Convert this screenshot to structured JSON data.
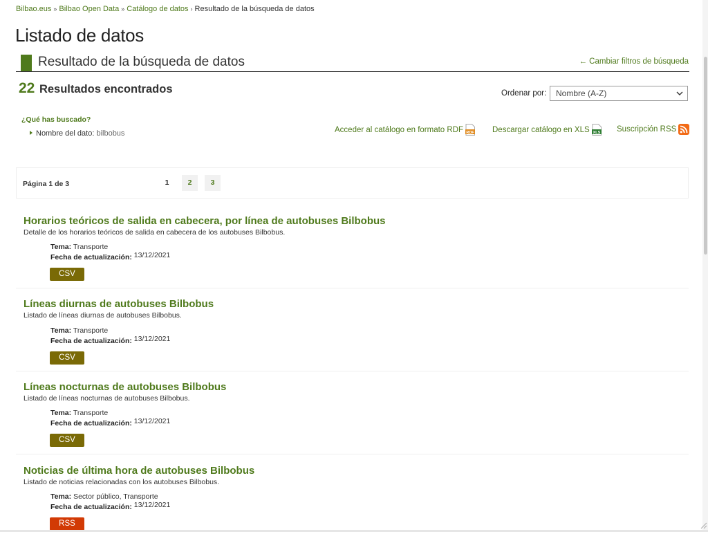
{
  "breadcrumb": [
    {
      "label": "Bilbao.eus",
      "link": true
    },
    {
      "label": "Bilbao Open Data",
      "link": true
    },
    {
      "label": "Catálogo de datos",
      "link": true
    },
    {
      "label": "Resultado de la búsqueda de datos",
      "link": false
    }
  ],
  "page_title": "Listado de datos",
  "section": {
    "title": "Resultado de la búsqueda de datos",
    "change_filters": "← Cambiar filtros de búsqueda"
  },
  "results": {
    "count": "22",
    "label": "Resultados encontrados"
  },
  "sort": {
    "label": "Ordenar por:",
    "value": "Nombre (A-Z)"
  },
  "search_summary": {
    "title": "¿Qué has buscado?",
    "criteria_label": "Nombre del dato:",
    "criteria_value": "bilbobus"
  },
  "downloads": {
    "rdf": "Acceder al catálogo en formato RDF",
    "xls": "Descargar catálogo en XLS",
    "rss": "Suscripción RSS"
  },
  "pagination": {
    "label": "Página 1 de 3",
    "pages": [
      "1",
      "2",
      "3"
    ],
    "current": "1"
  },
  "labels": {
    "tema": "Tema:",
    "fecha": "Fecha de actualización:"
  },
  "datasets": [
    {
      "title": "Horarios teóricos de salida en cabecera, por línea de autobuses Bilbobus",
      "description": "Detalle de los horarios teóricos de salida en cabecera de los autobuses Bilbobus.",
      "tema": "Transporte",
      "fecha": "13/12/2021",
      "format": "CSV"
    },
    {
      "title": "Líneas diurnas de autobuses Bilbobus",
      "description": "Listado de líneas diurnas de autobuses Bilbobus.",
      "tema": "Transporte",
      "fecha": "13/12/2021",
      "format": "CSV"
    },
    {
      "title": "Líneas nocturnas de autobuses Bilbobus",
      "description": "Listado de líneas nocturnas de autobuses Bilbobus.",
      "tema": "Transporte",
      "fecha": "13/12/2021",
      "format": "CSV"
    },
    {
      "title": "Noticias de última hora de autobuses Bilbobus",
      "description": "Listado de noticias relacionadas con los autobuses Bilbobus.",
      "tema": "Sector público, Transporte",
      "fecha": "13/12/2021",
      "format": "RSS"
    }
  ],
  "colors": {
    "accent": "#4f7a1c",
    "csv_badge": "#7a6a06",
    "rss_badge": "#d23a05"
  },
  "icons": [
    "chevron-down-icon",
    "rdf-file-icon",
    "xls-file-icon",
    "rss-feed-icon",
    "arrow-right-icon"
  ]
}
